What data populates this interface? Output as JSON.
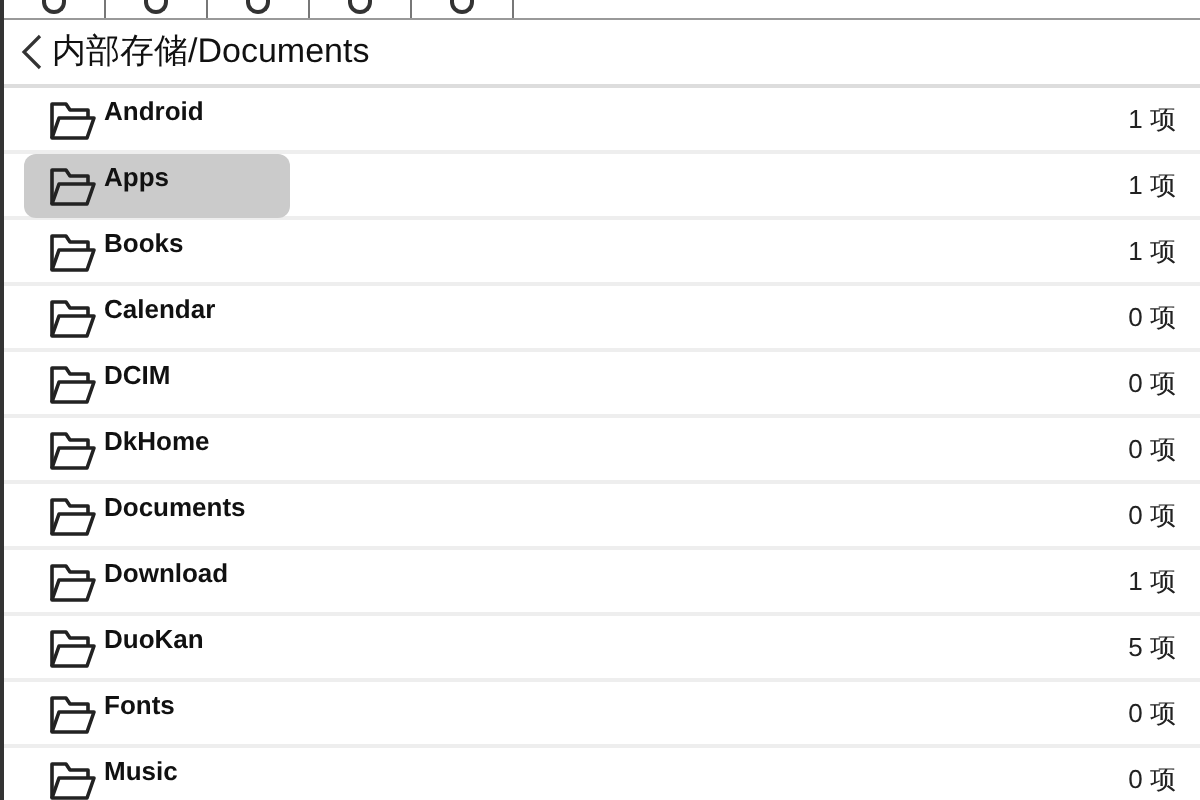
{
  "header": {
    "path": "内部存储/Documents"
  },
  "folders": [
    {
      "name": "Android",
      "count": "1 项",
      "selected": false
    },
    {
      "name": "Apps",
      "count": "1 项",
      "selected": true
    },
    {
      "name": "Books",
      "count": "1 项",
      "selected": false
    },
    {
      "name": "Calendar",
      "count": "0 项",
      "selected": false
    },
    {
      "name": "DCIM",
      "count": "0 项",
      "selected": false
    },
    {
      "name": "DkHome",
      "count": "0 项",
      "selected": false
    },
    {
      "name": "Documents",
      "count": "0 项",
      "selected": false
    },
    {
      "name": "Download",
      "count": "1 项",
      "selected": false
    },
    {
      "name": "DuoKan",
      "count": "5 项",
      "selected": false
    },
    {
      "name": "Fonts",
      "count": "0 项",
      "selected": false
    },
    {
      "name": "Music",
      "count": "0 项",
      "selected": false
    }
  ]
}
